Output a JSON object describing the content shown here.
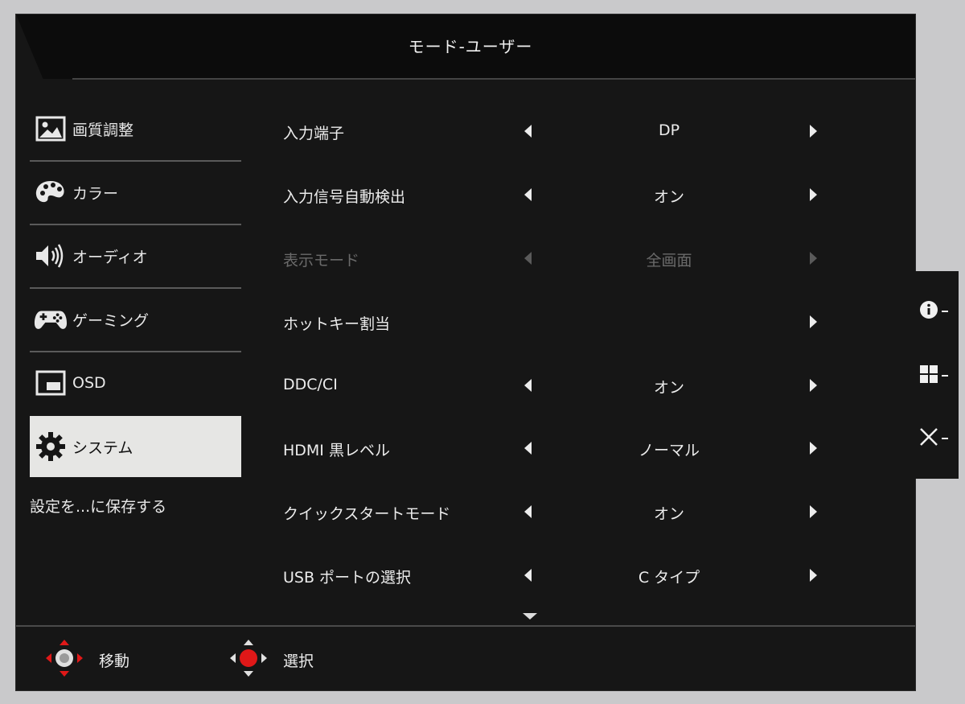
{
  "header": {
    "title": "モード-ユーザー"
  },
  "sidebar": {
    "items": [
      {
        "label": "画質調整",
        "icon": "picture-icon"
      },
      {
        "label": "カラー",
        "icon": "palette-icon"
      },
      {
        "label": "オーディオ",
        "icon": "speaker-icon"
      },
      {
        "label": "ゲーミング",
        "icon": "gamepad-icon"
      },
      {
        "label": "OSD",
        "icon": "osd-window-icon"
      },
      {
        "label": "システム",
        "icon": "gear-icon",
        "active": true
      }
    ],
    "save_label": "設定を...に保存する"
  },
  "settings": {
    "rows": [
      {
        "label": "入力端子",
        "value": "DP"
      },
      {
        "label": "入力信号自動検出",
        "value": "オン"
      },
      {
        "label": "表示モード",
        "value": "全画面",
        "disabled": true
      },
      {
        "label": "ホットキー割当",
        "value": ""
      },
      {
        "label": "DDC/CI",
        "value": "オン"
      },
      {
        "label": "HDMI 黒レベル",
        "value": "ノーマル"
      },
      {
        "label": "クイックスタートモード",
        "value": "オン"
      },
      {
        "label": "USB ポートの選択",
        "value": "C タイプ"
      }
    ]
  },
  "footer": {
    "move_label": "移動",
    "select_label": "選択"
  },
  "hotkeys": [
    {
      "icon": "info-icon"
    },
    {
      "icon": "grid-icon"
    },
    {
      "icon": "close-icon"
    }
  ],
  "colors": {
    "accent_red": "#e01818",
    "panel_bg": "#161616",
    "active_bg": "#e6e6e4"
  }
}
